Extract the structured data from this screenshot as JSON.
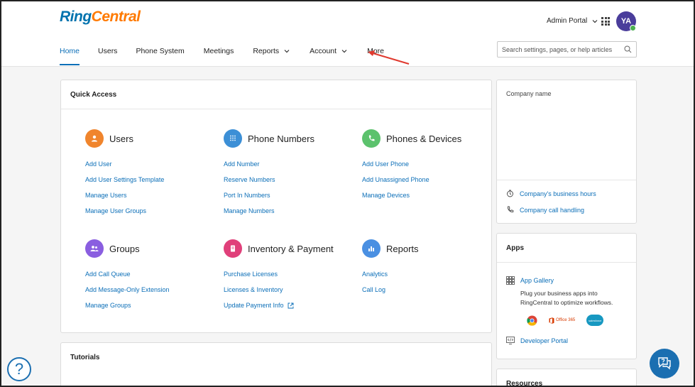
{
  "brand": {
    "part1": "Ring",
    "part2": "Central",
    "color_blue": "#0073ae",
    "color_orange": "#ff7a00"
  },
  "header": {
    "admin_portal_label": "Admin Portal",
    "avatar_initials": "YA",
    "search_placeholder": "Search settings, pages, or help articles"
  },
  "nav": {
    "items": [
      {
        "label": "Home",
        "active": true,
        "dropdown": false
      },
      {
        "label": "Users",
        "active": false,
        "dropdown": false
      },
      {
        "label": "Phone System",
        "active": false,
        "dropdown": false
      },
      {
        "label": "Meetings",
        "active": false,
        "dropdown": false
      },
      {
        "label": "Reports",
        "active": false,
        "dropdown": true
      },
      {
        "label": "Account",
        "active": false,
        "dropdown": true
      },
      {
        "label": "More",
        "active": false,
        "dropdown": false
      }
    ]
  },
  "quick_access": {
    "title": "Quick Access",
    "sections": [
      {
        "title": "Users",
        "icon": "user-icon",
        "color": "#f0852d",
        "links": [
          "Add User",
          "Add User Settings Template",
          "Manage Users",
          "Manage User Groups"
        ]
      },
      {
        "title": "Phone Numbers",
        "icon": "dialpad-icon",
        "color": "#3c8fd6",
        "links": [
          "Add Number",
          "Reserve Numbers",
          "Port In Numbers",
          "Manage Numbers"
        ]
      },
      {
        "title": "Phones & Devices",
        "icon": "phone-icon",
        "color": "#5cc26d",
        "links": [
          "Add User Phone",
          "Add Unassigned Phone",
          "Manage Devices"
        ]
      },
      {
        "title": "Groups",
        "icon": "group-icon",
        "color": "#8a5ee0",
        "links": [
          "Add Call Queue",
          "Add Message-Only Extension",
          "Manage Groups"
        ]
      },
      {
        "title": "Inventory & Payment",
        "icon": "receipt-icon",
        "color": "#e0407a",
        "links": [
          "Purchase Licenses",
          "Licenses & Inventory",
          "Update Payment Info"
        ]
      },
      {
        "title": "Reports",
        "icon": "bar-chart-icon",
        "color": "#4a90e2",
        "links": [
          "Analytics",
          "Call Log"
        ]
      }
    ]
  },
  "tutorials": {
    "title": "Tutorials"
  },
  "company": {
    "name_label": "Company name",
    "business_hours": "Company's business hours",
    "call_handling": "Company call handling"
  },
  "apps": {
    "title": "Apps",
    "gallery": "App Gallery",
    "description": "Plug your business apps into RingCentral to optimize workflows.",
    "office_label": "Office 365",
    "salesforce_label": "salesforce",
    "developer_portal": "Developer Portal"
  },
  "resources": {
    "title": "Resources"
  },
  "help": {
    "glyph": "?"
  }
}
